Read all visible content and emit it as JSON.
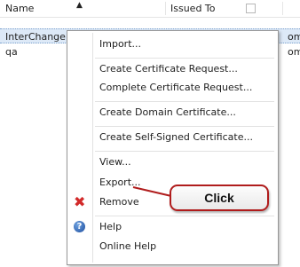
{
  "list": {
    "columns": {
      "name": "Name",
      "issued_to": "Issued To"
    },
    "rows": [
      {
        "name": "InterChange",
        "issued_to": "om",
        "selected": true
      },
      {
        "name": "qa",
        "issued_to": "om",
        "selected": false
      }
    ]
  },
  "context_menu": {
    "items": [
      {
        "id": "import",
        "label": "Import..."
      },
      {
        "id": "create-cert-request",
        "label": "Create Certificate Request..."
      },
      {
        "id": "complete-cert-request",
        "label": "Complete Certificate Request..."
      },
      {
        "id": "create-domain-cert",
        "label": "Create Domain Certificate..."
      },
      {
        "id": "create-self-signed",
        "label": "Create Self-Signed Certificate..."
      },
      {
        "id": "view",
        "label": "View..."
      },
      {
        "id": "export",
        "label": "Export..."
      },
      {
        "id": "remove",
        "label": "Remove",
        "icon": "remove-icon"
      },
      {
        "id": "help",
        "label": "Help",
        "icon": "help-icon"
      },
      {
        "id": "online-help",
        "label": "Online Help"
      }
    ]
  },
  "callout": {
    "text": "Click",
    "color": "#b01c1c"
  },
  "colors": {
    "selection": "#dde9f7",
    "remove_icon": "#d22a2a",
    "help_icon": "#1d4d9e"
  }
}
